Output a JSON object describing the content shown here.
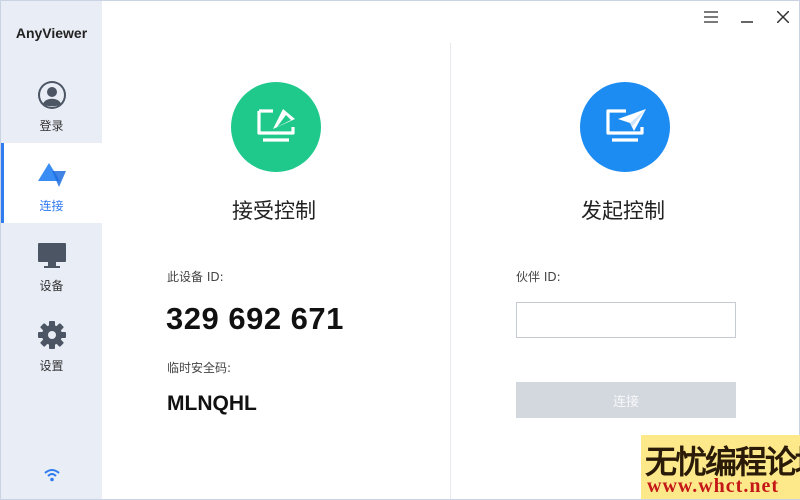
{
  "app": {
    "title": "AnyViewer"
  },
  "sidebar": {
    "items": [
      {
        "label": "登录",
        "icon": "user-icon"
      },
      {
        "label": "连接",
        "icon": "connect-triangle-icon",
        "active": true
      },
      {
        "label": "设备",
        "icon": "monitor-icon"
      },
      {
        "label": "设置",
        "icon": "gear-icon"
      }
    ],
    "status_icon": "wifi-icon"
  },
  "window_controls": [
    "menu-icon",
    "minimize-icon",
    "close-icon"
  ],
  "accept_panel": {
    "title": "接受控制",
    "device_id_label": "此设备 ID:",
    "device_id": "329 692 671",
    "temp_code_label": "临时安全码:",
    "temp_code": "MLNQHL",
    "icon": "screen-share-icon",
    "color": "#1fc98b"
  },
  "initiate_panel": {
    "title": "发起控制",
    "partner_id_label": "伙伴 ID:",
    "partner_id_value": "",
    "connect_label": "连接",
    "icon": "screen-send-icon",
    "color": "#1d8cf2"
  },
  "watermark": {
    "text": "无忧编程论坛",
    "url": "www.whct.net"
  },
  "colors": {
    "accent": "#2f7bf0",
    "sidebar_bg": "#e9edf5",
    "button_disabled": "#d3d7de"
  }
}
